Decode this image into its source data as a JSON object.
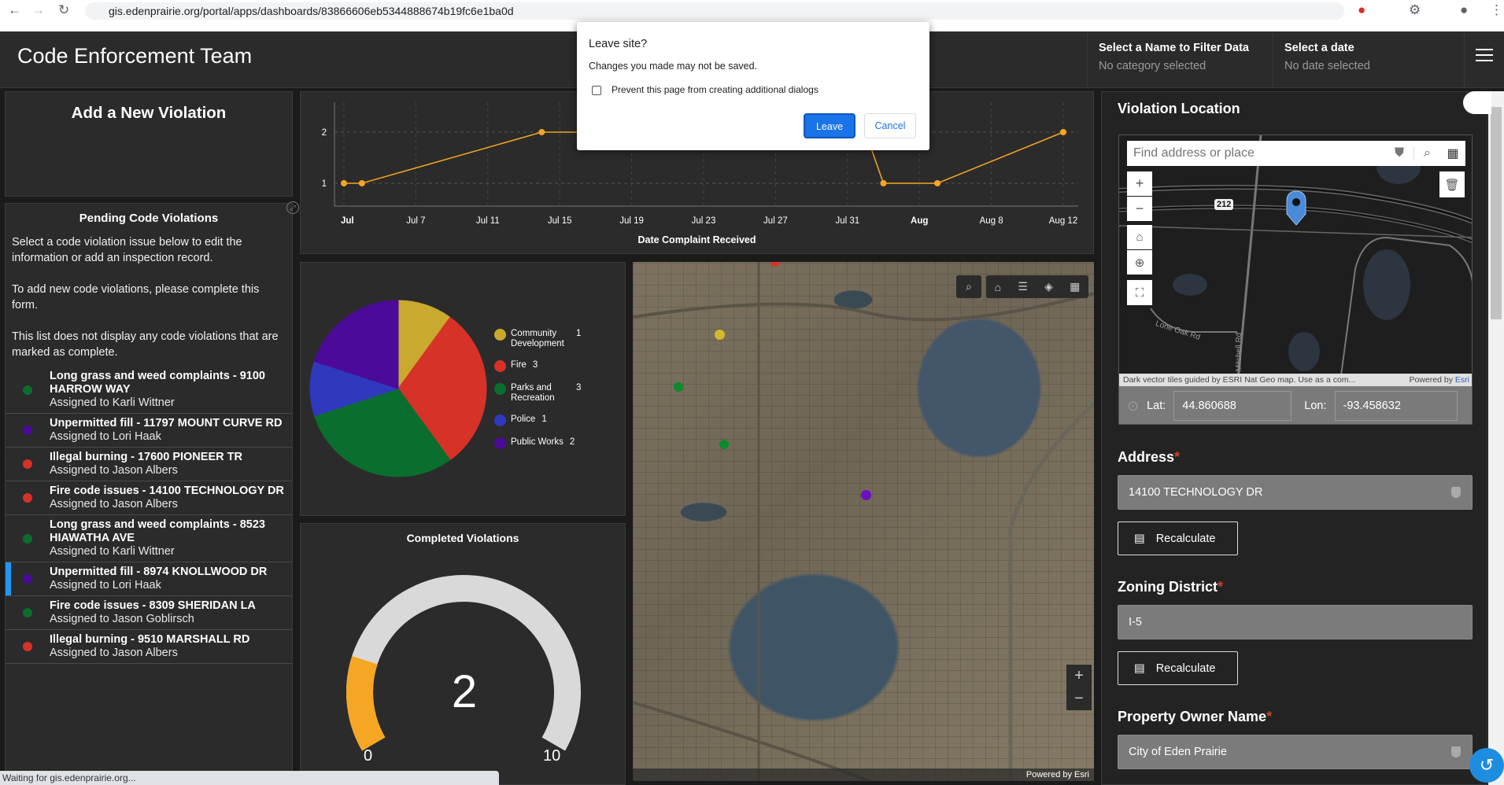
{
  "browser": {
    "url": "gis.edenprairie.org/portal/apps/dashboards/83866606eb5344888674b19fc6e1ba0d",
    "status": "Waiting for gis.edenprairie.org..."
  },
  "header": {
    "title": "Code Enforcement Team",
    "filters": [
      {
        "label": "Select a Name to Filter Data",
        "value": "No category selected"
      },
      {
        "label": "Select a date",
        "value": "No date selected"
      }
    ]
  },
  "dialog": {
    "title": "Leave site?",
    "message": "Changes you made may not be saved.",
    "checkbox_label": "Prevent this page from creating additional dialogs",
    "checkbox_checked": false,
    "leave": "Leave",
    "cancel": "Cancel"
  },
  "add_panel": {
    "title": "Add a New Violation"
  },
  "pending": {
    "title": "Pending Code Violations",
    "paragraphs": [
      "Select a code violation issue below to edit the information or add an inspection record.",
      "To add new code violations, please complete this form.",
      "This list does not display any code violations that are marked as complete."
    ],
    "items": [
      {
        "title": "Long grass and weed complaints - 9100 HARROW WAY",
        "assigned": "Assigned to Karli Wittner",
        "color": "#0a6e2e"
      },
      {
        "title": "Unpermitted fill - 11797 MOUNT CURVE RD",
        "assigned": "Assigned to Lori Haak",
        "color": "#4b0a9a"
      },
      {
        "title": "Illegal burning - 17600 PIONEER TR",
        "assigned": "Assigned to Jason Albers",
        "color": "#d63228"
      },
      {
        "title": "Fire code issues - 14100 TECHNOLOGY DR",
        "assigned": "Assigned to Jason Albers",
        "color": "#d63228"
      },
      {
        "title": "Long grass and weed complaints - 8523 HIAWATHA AVE",
        "assigned": "Assigned to Karli Wittner",
        "color": "#0a6e2e"
      },
      {
        "title": "Unpermitted fill - 8974 KNOLLWOOD DR",
        "assigned": "Assigned to Lori Haak",
        "color": "#4b0a9a",
        "selected": true
      },
      {
        "title": "Fire code issues - 8309 SHERIDAN LA",
        "assigned": "Assigned to Jason Goblirsch",
        "color": "#0a6e2e"
      },
      {
        "title": "Illegal burning - 9510 MARSHALL RD",
        "assigned": "Assigned to Jason Albers",
        "color": "#d63228"
      }
    ]
  },
  "chart_data": [
    {
      "type": "line",
      "xlabel": "Date Complaint Received",
      "ylabel": "",
      "x_ticks": [
        "Jul",
        "Jul 7",
        "Jul 11",
        "Jul 15",
        "Jul 19",
        "Jul 23",
        "Jul 27",
        "Jul 31",
        "Aug",
        "Aug 8",
        "Aug 12"
      ],
      "y_ticks": [
        "1",
        "2"
      ],
      "grid": true,
      "color": "#f5a623",
      "points": [
        {
          "x": "Jul 3",
          "y": 1
        },
        {
          "x": "Jul 4",
          "y": 1
        },
        {
          "x": "Jul 14",
          "y": 2
        },
        {
          "x": "Aug 1",
          "y": 2
        },
        {
          "x": "Aug 2",
          "y": 1
        },
        {
          "x": "Aug 5",
          "y": 1
        },
        {
          "x": "Aug 12",
          "y": 2
        }
      ]
    },
    {
      "type": "pie",
      "legend": "right",
      "slices": [
        {
          "label": "Community Development",
          "value": 1,
          "color": "#c9a92e"
        },
        {
          "label": "Fire",
          "value": 3,
          "color": "#d63228"
        },
        {
          "label": "Parks and Recreation",
          "value": 3,
          "color": "#0a6e2e"
        },
        {
          "label": "Police",
          "value": 1,
          "color": "#3038bd"
        },
        {
          "label": "Public Works",
          "value": 2,
          "color": "#4b0a9a"
        }
      ]
    },
    {
      "type": "gauge",
      "title": "Completed Violations",
      "value": 2,
      "min": 0,
      "max": 10,
      "min_label": "0",
      "max_label": "10",
      "color": "#f5a623",
      "track": "#d9d9d9"
    }
  ],
  "map": {
    "attribution": "Powered by Esri"
  },
  "form": {
    "location_title": "Violation Location",
    "search_placeholder": "Find address or place",
    "attribution": "Dark vector tiles guided by ESRI Nat Geo map. Use as a com...",
    "powered": "Powered by ",
    "esri": "Esri",
    "road_shield": "212",
    "road1": "Lone Oak Rd",
    "road2": "Mitchell Rd",
    "lat_label": "Lat:",
    "lat": "44.860688",
    "lon_label": "Lon:",
    "lon": "-93.458632",
    "address_label": "Address",
    "address": "14100 TECHNOLOGY DR",
    "recalculate": "Recalculate",
    "zoning_label": "Zoning District",
    "zoning": "I-5",
    "owner_label": "Property Owner Name",
    "owner": "City of Eden Prairie",
    "req": "*"
  }
}
